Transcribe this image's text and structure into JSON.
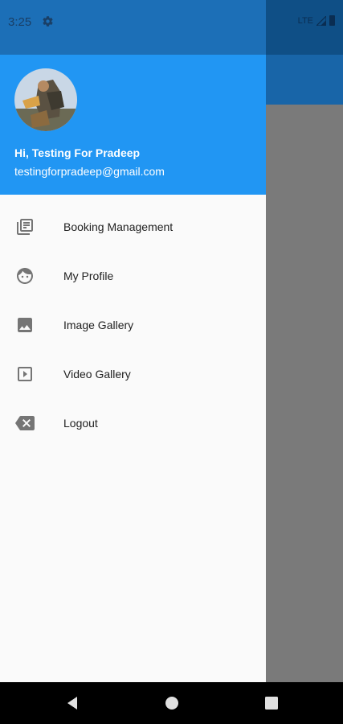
{
  "status_bar": {
    "time": "3:25",
    "network": "LTE",
    "icons": [
      "gear-icon",
      "signal-icon",
      "battery-icon"
    ]
  },
  "drawer": {
    "header": {
      "greeting": "Hi, Testing For Pradeep",
      "email": "testingforpradeep@gmail.com",
      "background_color": "#2196f3"
    },
    "items": [
      {
        "label": "Booking Management",
        "icon": "library-books-icon"
      },
      {
        "label": "My Profile",
        "icon": "face-icon"
      },
      {
        "label": "Image Gallery",
        "icon": "image-icon"
      },
      {
        "label": "Video Gallery",
        "icon": "video-icon"
      },
      {
        "label": "Logout",
        "icon": "backspace-icon"
      }
    ]
  },
  "colors": {
    "accent": "#2196f3",
    "scrim": "#757575",
    "icon": "#757575"
  },
  "nav_bar": {
    "buttons": [
      "back-icon",
      "home-icon",
      "recents-icon"
    ]
  }
}
